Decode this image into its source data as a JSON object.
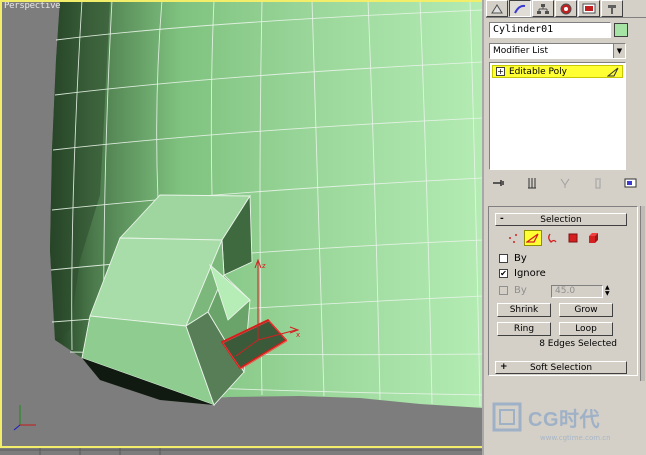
{
  "viewport": {
    "label": "Perspective"
  },
  "panel": {
    "tabs": [
      "create",
      "modify",
      "hierarchy",
      "motion",
      "display",
      "utilities"
    ],
    "object_name": "Cylinder01",
    "object_color": "#a6e4a6",
    "modifier_list": "Modifier List",
    "stack": {
      "item": "Editable Poly"
    },
    "selection": {
      "title": "Selection",
      "by_vertex_label": "By",
      "ignore_backfacing_label": "Ignore",
      "by_angle_label": "By",
      "angle_value": "45.0",
      "shrink": "Shrink",
      "grow": "Grow",
      "ring": "Ring",
      "loop": "Loop",
      "status": "8 Edges Selected"
    },
    "soft_selection": {
      "title": "Soft Selection"
    }
  },
  "watermark": {
    "brand": "CG时代",
    "site": "www.cgtime.com.cn"
  }
}
